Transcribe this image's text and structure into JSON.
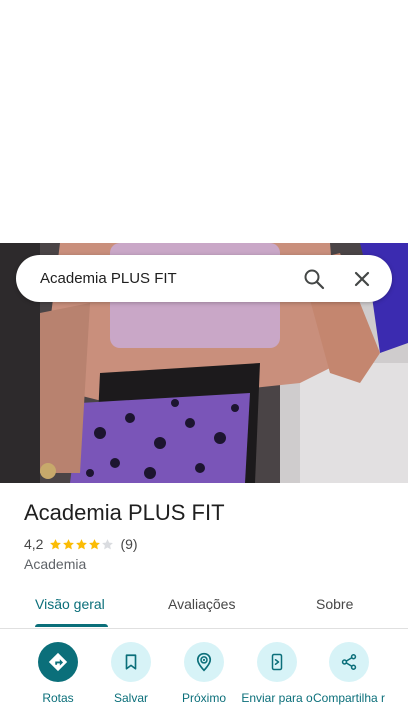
{
  "search": {
    "query": "Academia PLUS FIT"
  },
  "place": {
    "title": "Academia PLUS FIT",
    "rating": "4,2",
    "stars": 4,
    "reviews": "(9)",
    "category": "Academia"
  },
  "tabs": [
    {
      "label": "Visão geral",
      "active": true
    },
    {
      "label": "Avaliações",
      "active": false
    },
    {
      "label": "Sobre",
      "active": false
    }
  ],
  "actions": [
    {
      "label": "Rotas",
      "icon": "directions-icon"
    },
    {
      "label": "Salvar",
      "icon": "bookmark-icon"
    },
    {
      "label": "Próximo",
      "icon": "nearby-icon"
    },
    {
      "label": "Enviar para o",
      "icon": "send-to-phone-icon"
    },
    {
      "label": "Compartilha r",
      "icon": "share-icon"
    }
  ],
  "colors": {
    "accent": "#0b6f7a",
    "star": "#fbbc04",
    "chip": "#d7f3f7"
  }
}
